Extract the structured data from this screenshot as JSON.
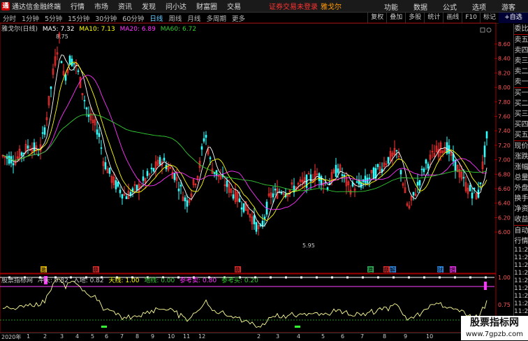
{
  "menubar": {
    "app_name": "通达信金融终端",
    "items": [
      "行情",
      "市场",
      "资讯",
      "发现",
      "问小达",
      "财富圈",
      "交易"
    ],
    "warning": "证券交易未登录",
    "stock": "雅戈尔",
    "right_items": [
      "功能",
      "数据",
      "公式",
      "选项"
    ],
    "user": "游客"
  },
  "tabbar": {
    "tabs": [
      "分时",
      "1分钟",
      "5分钟",
      "15分钟",
      "30分钟",
      "60分钟",
      "日线",
      "周线",
      "月线",
      "多周期",
      "更多"
    ],
    "active_tab": "日线",
    "right_buttons": [
      "复权",
      "叠加",
      "多股",
      "统计",
      "画线",
      "F10",
      "标记"
    ],
    "add_select": "+自选"
  },
  "ma_line": {
    "title": "雅戈尔(日线)",
    "ma5": "MA5: 7.32",
    "ma10": "MA10: 7.13",
    "ma20": "MA20: 6.89",
    "ma60": "MA60: 6.72"
  },
  "price_axis": [
    "8.60",
    "8.40",
    "8.20",
    "8.00",
    "7.80",
    "7.60",
    "7.40",
    "7.20",
    "7.00",
    "6.80",
    "6.60",
    "6.40",
    "6.20",
    "6.00"
  ],
  "price_annotations": {
    "high": "8.75",
    "low": "5.95"
  },
  "markers": [
    {
      "label": "激",
      "color": "#ffcc00"
    },
    {
      "label": "鼎",
      "color": "#ff3333"
    },
    {
      "label": "鼎",
      "color": "#ff3333"
    },
    {
      "label": "港",
      "color": "#33cc66"
    },
    {
      "label": "鼎",
      "color": "#ff3333"
    },
    {
      "label": "解",
      "color": "#3399ff"
    },
    {
      "label": "财",
      "color": "#3399ff"
    },
    {
      "label": "增",
      "color": "#ff33ff"
    }
  ],
  "indicator": {
    "name": "股票指标网",
    "chongtian": "冲天: 0.82",
    "rudi": "入地: 0.82",
    "tianxian": "天线: 1.00",
    "dixian": "地线: 0.00",
    "cankao_mai": "参考卖: 0.80",
    "cankao_mai2": "参考买: 0.20",
    "axis": [
      "1.00",
      "0.75"
    ]
  },
  "sidebar": {
    "labels": [
      "委比",
      "卖五",
      "卖四",
      "卖三",
      "卖二",
      "卖一",
      "买一",
      "买二",
      "买三",
      "买四",
      "买五",
      "现价",
      "涨跌",
      "涨幅",
      "总量",
      "外盘",
      "换手",
      "净资",
      "收益"
    ],
    "lower": [
      "自动",
      "行情"
    ],
    "times": [
      "11:29",
      "11:29",
      "11:29",
      "11:29",
      "11:29",
      "11:29",
      "11:29",
      "11:29",
      "11:29",
      "11:29",
      "11:29"
    ]
  },
  "bottom_axis": {
    "year": "2020年",
    "months": [
      "1",
      "2",
      "3",
      "4",
      "5",
      "6",
      "7",
      "8",
      "9",
      "10",
      "11",
      "12",
      "2",
      "3",
      "4",
      "5",
      "6",
      "7",
      "8",
      "9",
      "10"
    ]
  },
  "watermark": {
    "title": "股票指标网",
    "url": "www.7gpzb.com"
  },
  "colors": {
    "up": "#ff3333",
    "down": "#33ffff",
    "ma5": "#ffffff",
    "ma10": "#ffff00",
    "ma20": "#ff33ff",
    "ma60": "#33cc33",
    "indicator_line": "#ffff99",
    "purple_line": "#cc33cc"
  }
}
